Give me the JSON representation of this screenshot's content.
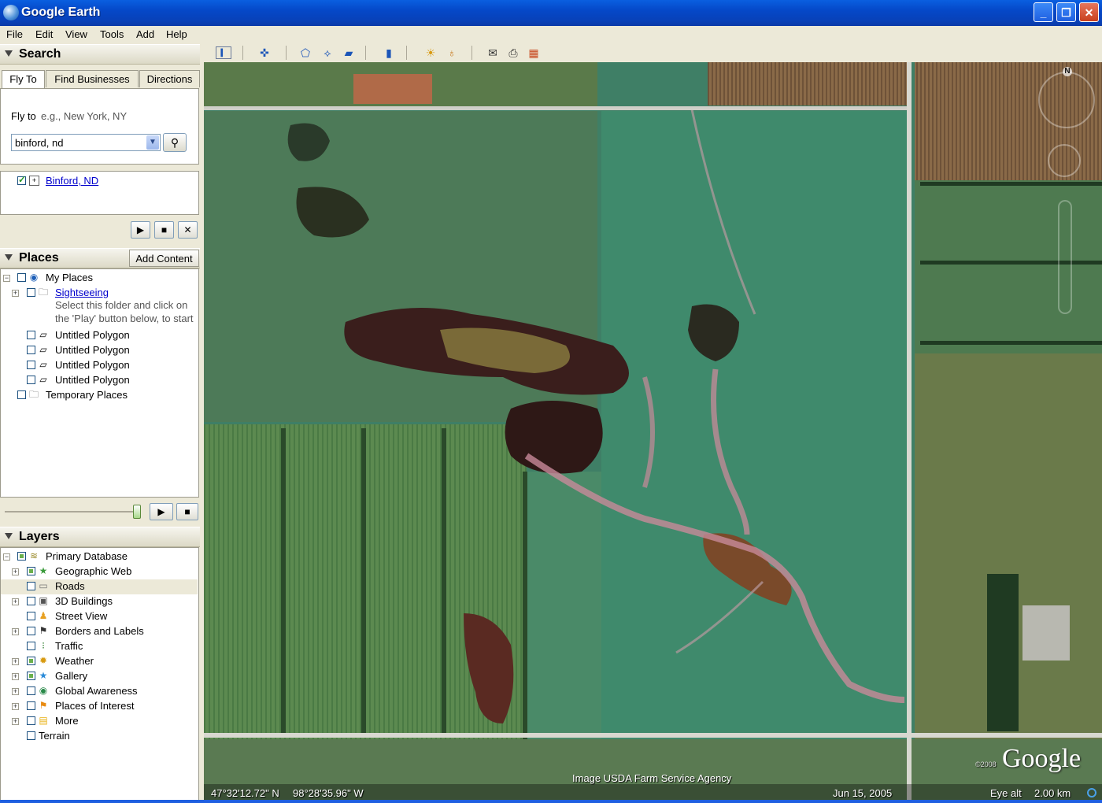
{
  "window": {
    "title": "Google Earth"
  },
  "menu": [
    "File",
    "Edit",
    "View",
    "Tools",
    "Add",
    "Help"
  ],
  "search": {
    "header": "Search",
    "tabs": [
      "Fly To",
      "Find Businesses",
      "Directions"
    ],
    "fly_label": "Fly to",
    "fly_hint": "e.g., New York, NY",
    "input_value": "binford, nd",
    "result": "Binford, ND"
  },
  "places": {
    "header": "Places",
    "add_content": "Add Content",
    "items": {
      "my_places": "My Places",
      "sightseeing": "Sightseeing",
      "sightseeing_desc_1": "Select this folder and click on",
      "sightseeing_desc_2": "the 'Play' button below, to start",
      "poly1": "Untitled Polygon",
      "poly2": "Untitled Polygon",
      "poly3": "Untitled Polygon",
      "poly4": "Untitled Polygon",
      "temporary": "Temporary Places"
    }
  },
  "layers": {
    "header": "Layers",
    "items": {
      "primary": "Primary Database",
      "geoweb": "Geographic Web",
      "roads": "Roads",
      "buildings": "3D Buildings",
      "streetview": "Street View",
      "borders": "Borders and Labels",
      "traffic": "Traffic",
      "weather": "Weather",
      "gallery": "Gallery",
      "awareness": "Global Awareness",
      "poi": "Places of Interest",
      "more": "More",
      "terrain": "Terrain"
    }
  },
  "map": {
    "credit": "Image USDA Farm Service Agency",
    "lat": "47°32'12.72\" N",
    "lon": "98°28'35.96\" W",
    "date": "Jun 15, 2005",
    "eye_label": "Eye alt",
    "eye_value": "2.00 km",
    "logo": "Google",
    "copyright": "©2008",
    "north": "N"
  }
}
